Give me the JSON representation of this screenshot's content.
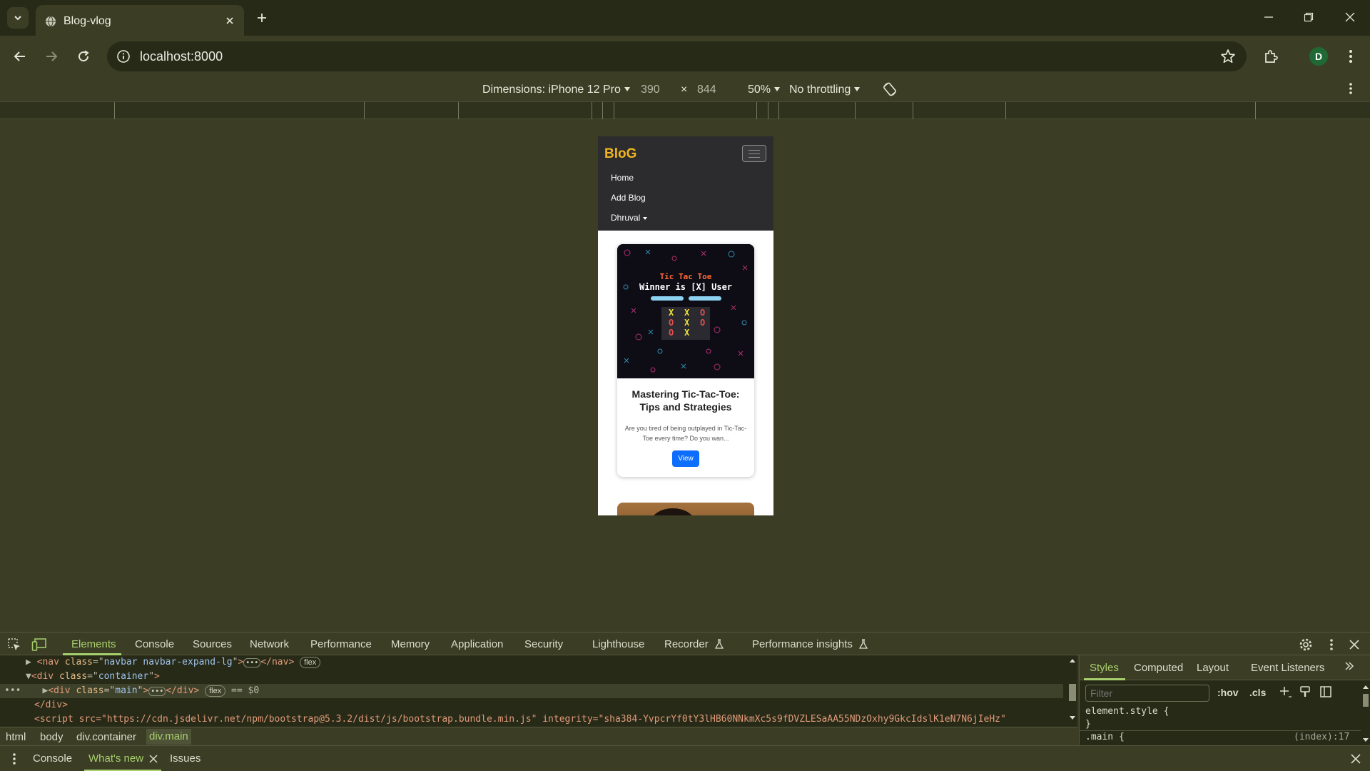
{
  "browser": {
    "tab_title": "Blog-vlog",
    "url": "localhost:8000",
    "profile_initial": "D"
  },
  "device_toolbar": {
    "dimensions_label": "Dimensions: iPhone 12 Pro",
    "width": "390",
    "times": "×",
    "height": "844",
    "zoom": "50%",
    "throttling": "No throttling"
  },
  "page": {
    "brand": "BloG",
    "nav_links": [
      "Home",
      "Add Blog",
      "Dhruval"
    ],
    "card": {
      "image_title": "Tic Tac Toe",
      "image_subtitle": "Winner is [X] User",
      "title": "Mastering Tic-Tac-Toe: Tips and Strategies",
      "text": "Are you tired of being outplayed in Tic-Tac-Toe every time? Do you wan...",
      "button": "View"
    }
  },
  "devtools": {
    "tabs": [
      "Elements",
      "Console",
      "Sources",
      "Network",
      "Performance",
      "Memory",
      "Application",
      "Security",
      "Lighthouse",
      "Recorder",
      "Performance insights"
    ],
    "dom": {
      "nav_tag": "nav",
      "nav_class": "navbar navbar-expand-lg",
      "container_class": "container",
      "main_class": "main",
      "flex": "flex",
      "selected_marker": "== $0",
      "close_div": "</div>",
      "script_line": "<script src=\"https://cdn.jsdelivr.net/npm/bootstrap@5.3.2/dist/js/bootstrap.bundle.min.js\" integrity=\"sha384-YvpcrYf0tY3lHB60NNkmXc5s9fDVZLESaAA55NDzOxhy9GkcIdslK1eN7N6jIeHz\""
    },
    "breadcrumbs": [
      "html",
      "body",
      "div.container",
      "div.main"
    ],
    "styles_tabs": [
      "Styles",
      "Computed",
      "Layout",
      "Event Listeners"
    ],
    "filter_placeholder": "Filter",
    "hov": ":hov",
    "cls": ".cls",
    "element_style": "element.style {",
    "close_brace": "}",
    "next_rule": ".main {",
    "next_rule_source": "(index):17",
    "drawer_tabs": [
      "Console",
      "What's new",
      "Issues"
    ]
  },
  "colors": {
    "accent": "#a8cf6e",
    "brand_yellow": "#f1b520",
    "primary_button": "#0d6efd"
  }
}
